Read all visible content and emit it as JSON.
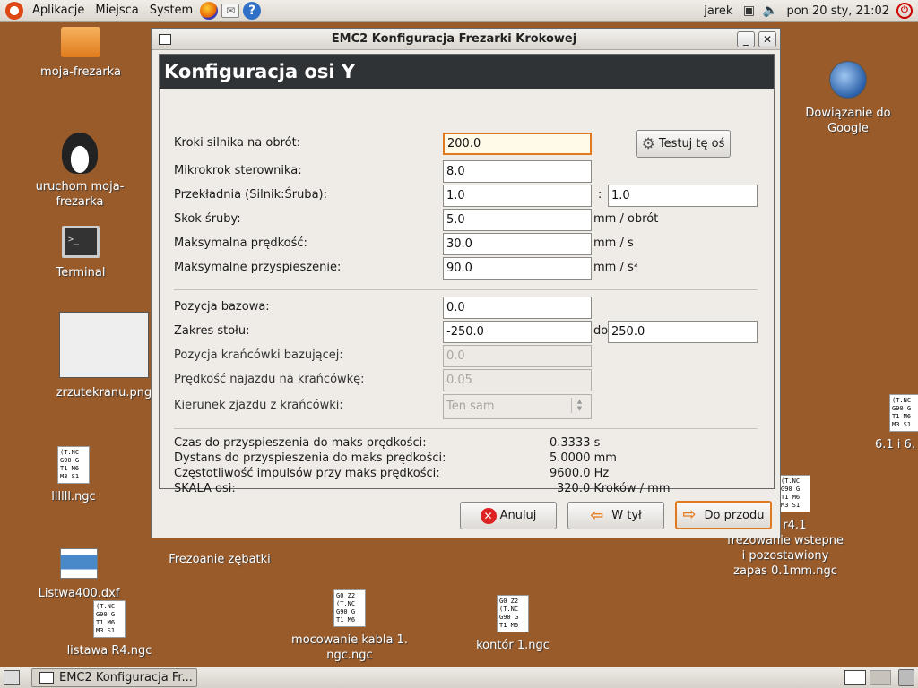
{
  "top_panel": {
    "menus": [
      "Aplikacje",
      "Miejsca",
      "System"
    ],
    "user": "jarek",
    "clock": "pon 20 sty, 21:02",
    "help_glyph": "?"
  },
  "desktop_icons": {
    "moja_frezarka": "moja-frezarka",
    "uruchom_line1": "uruchom moja-",
    "uruchom_line2": "frezarka",
    "terminal": "Terminal",
    "zrzut": "zrzutekranu.png",
    "lllll": "llllll.ngc",
    "frezowanie_zebatki": "Frezoanie zębatki",
    "listwa400": "Listwa400.dxf",
    "listawa_r4": "listawa R4.ngc",
    "mocowanie_line1": "mocowanie kabla 1.",
    "mocowanie_line2": "ngc.ngc",
    "kontor": "kontór 1.ngc",
    "google_line1": "Dowiązanie do",
    "google_line2": "Google",
    "right_ngc": "6.1 i 6.",
    "r41_line1": "00 r4.1",
    "r41_line2": "frezowanie wstepne",
    "r41_line3": "i pozostawiony",
    "r41_line4": "zapas 0.1mm.ngc",
    "ngc_text": "(T.NC\nG90 G\nT1 M6\nM3 S1",
    "ngc_text2": "G0 Z2\n(T.NC\nG90 G\nT1 M6"
  },
  "window": {
    "title": "EMC2 Konfiguracja Frezarki Krokowej",
    "minimize_glyph": "_",
    "close_glyph": "✕",
    "header": "Konfiguracja osi Y",
    "fields": {
      "steps_label": "Kroki silnika na obrót:",
      "steps_value": "200.0",
      "microstep_label": "Mikrokrok sterownika:",
      "microstep_value": "8.0",
      "gear_label": "Przekładnia (Silnik:Śruba):",
      "gear_motor": "1.0",
      "gear_sep": ":",
      "gear_screw": "1.0",
      "pitch_label": "Skok śruby:",
      "pitch_value": "5.0",
      "pitch_unit": "mm / obrót",
      "maxvel_label": "Maksymalna prędkość:",
      "maxvel_value": "30.0",
      "maxvel_unit": "mm / s",
      "maxacc_label": "Maksymalne przyspieszenie:",
      "maxacc_value": "90.0",
      "maxacc_unit": "mm / s²",
      "home_label": "Pozycja bazowa:",
      "home_value": "0.0",
      "range_label": "Zakres stołu:",
      "range_min": "-250.0",
      "range_sep": "do",
      "range_max": "250.0",
      "homesw_label": "Pozycja krańcówki bazującej:",
      "homesw_value": "0.0",
      "searchvel_label": "Prędkość najazdu na krańcówkę:",
      "searchvel_value": "0.05",
      "latchdir_label": "Kierunek zjazdu z krańcówki:",
      "latchdir_value": "Ten sam"
    },
    "test_button": "Testuj tę oś",
    "info": {
      "time_label": "Czas do przyspieszenia do maks prędkości:",
      "time_value": "0.3333 s",
      "dist_label": "Dystans do przyspieszenia do maks prędkości:",
      "dist_value": "5.0000 mm",
      "freq_label": "Częstotliwość impulsów przy maks prędkości:",
      "freq_value": "9600.0 Hz",
      "scale_label": "SKALA osi:",
      "scale_value": "320.0 Kroków / mm"
    },
    "buttons": {
      "cancel": "Anuluj",
      "back": "W tył",
      "forward": "Do przodu"
    }
  },
  "taskbar": {
    "window_button": "EMC2 Konfiguracja Fr..."
  }
}
